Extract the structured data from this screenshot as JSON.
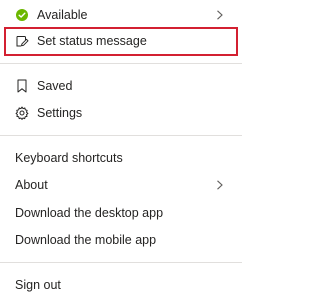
{
  "status": {
    "label": "Available",
    "color": "#6bb700"
  },
  "status_message": {
    "label": "Set status message",
    "highlight_color": "#d32031"
  },
  "saved": {
    "label": "Saved"
  },
  "settings": {
    "label": "Settings"
  },
  "links": {
    "keyboard_shortcuts": "Keyboard shortcuts",
    "about": "About",
    "download_desktop": "Download the desktop app",
    "download_mobile": "Download the mobile app"
  },
  "sign_out": {
    "label": "Sign out"
  },
  "icons": {
    "status": "green-circle-check-icon",
    "status_message": "pencil-edit-icon",
    "saved": "bookmark-icon",
    "settings": "gear-icon",
    "submenu": "chevron-right-icon"
  }
}
